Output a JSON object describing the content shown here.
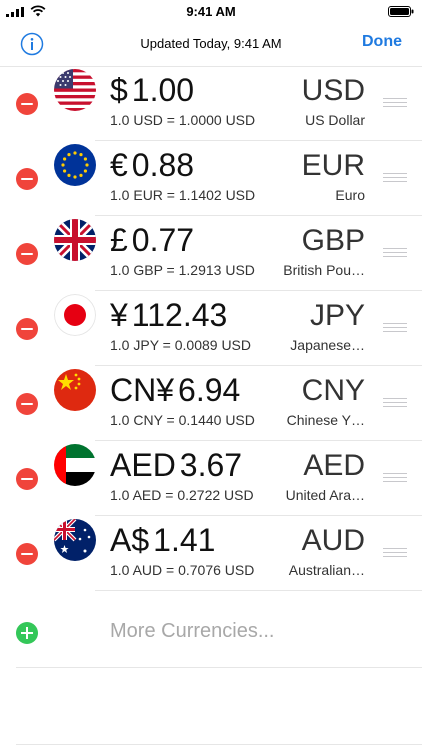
{
  "status_bar": {
    "time": "9:41 AM"
  },
  "nav": {
    "title": "Updated Today, 9:41 AM",
    "done_label": "Done"
  },
  "currencies": [
    {
      "symbol": "$",
      "amount": "1.00",
      "rate": "1.0 USD = 1.0000 USD",
      "code": "USD",
      "name": "US Dollar",
      "flag": "us-flag"
    },
    {
      "symbol": "€",
      "amount": "0.88",
      "rate": "1.0 EUR = 1.1402 USD",
      "code": "EUR",
      "name": "Euro",
      "flag": "eu-flag"
    },
    {
      "symbol": "£",
      "amount": "0.77",
      "rate": "1.0 GBP = 1.2913 USD",
      "code": "GBP",
      "name": "British Pou…",
      "flag": "uk-flag"
    },
    {
      "symbol": "¥",
      "amount": "112.43",
      "rate": "1.0 JPY = 0.0089 USD",
      "code": "JPY",
      "name": "Japanese…",
      "flag": "japan-flag"
    },
    {
      "symbol": "CN¥",
      "amount": "6.94",
      "rate": "1.0 CNY = 0.1440 USD",
      "code": "CNY",
      "name": "Chinese Y…",
      "flag": "china-flag"
    },
    {
      "symbol": "AED",
      "amount": "3.67",
      "rate": "1.0 AED = 0.2722 USD",
      "code": "AED",
      "name": "United Ara…",
      "flag": "uae-flag"
    },
    {
      "symbol": "A$",
      "amount": "1.41",
      "rate": "1.0 AUD = 0.7076 USD",
      "code": "AUD",
      "name": "Australian…",
      "flag": "australia-flag"
    }
  ],
  "more": {
    "label": "More Currencies..."
  },
  "colors": {
    "accent": "#1f7ae0",
    "delete": "#f0443b",
    "add": "#34c759"
  }
}
